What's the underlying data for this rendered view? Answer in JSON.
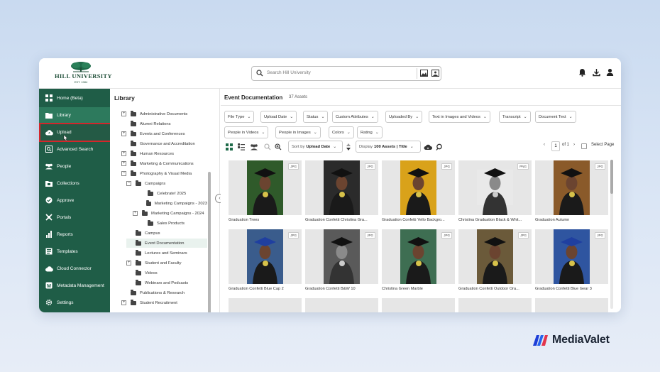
{
  "header": {
    "logo_name": "HILL UNIVERSITY",
    "logo_est": "EST. 1984",
    "search_placeholder": "Search Hill University"
  },
  "sidebar": {
    "items": [
      {
        "label": "Home (Beta)",
        "icon": "home-icon"
      },
      {
        "label": "Library",
        "icon": "folder-icon"
      },
      {
        "label": "Upload",
        "icon": "cloud-upload-icon"
      },
      {
        "label": "Advanced Search",
        "icon": "advanced-search-icon"
      },
      {
        "label": "People",
        "icon": "people-icon"
      },
      {
        "label": "Collections",
        "icon": "collections-icon"
      },
      {
        "label": "Approve",
        "icon": "approve-icon"
      },
      {
        "label": "Portals",
        "icon": "portals-icon"
      },
      {
        "label": "Reports",
        "icon": "reports-icon"
      },
      {
        "label": "Templates",
        "icon": "templates-icon"
      },
      {
        "label": "Cloud Connector",
        "icon": "cloud-connector-icon"
      },
      {
        "label": "Metadata Management",
        "icon": "metadata-icon"
      },
      {
        "label": "Settings",
        "icon": "gear-icon"
      }
    ]
  },
  "tree": {
    "title": "Library",
    "nodes": [
      {
        "label": "Administrative Documents",
        "expander": "+"
      },
      {
        "label": "Alumni Relations",
        "expander": ""
      },
      {
        "label": "Events and Conferences",
        "expander": "+"
      },
      {
        "label": "Governance and Accreditation",
        "expander": ""
      },
      {
        "label": "Human Resources",
        "expander": "+"
      },
      {
        "label": "Marketing & Communications",
        "expander": "+"
      },
      {
        "label": "Photography & Visual Media",
        "expander": "−"
      },
      {
        "label": "Campaigns",
        "expander": "−"
      },
      {
        "label": "Celebrate! 2025",
        "expander": ""
      },
      {
        "label": "Marketing Campaigns - 2023",
        "expander": ""
      },
      {
        "label": "Marketing Campaigns - 2024",
        "expander": "+"
      },
      {
        "label": "Sales Products",
        "expander": ""
      },
      {
        "label": "Campus",
        "expander": ""
      },
      {
        "label": "Event Documentation",
        "expander": ""
      },
      {
        "label": "Lectures and Seminars",
        "expander": ""
      },
      {
        "label": "Student and Faculty",
        "expander": "+"
      },
      {
        "label": "Videos",
        "expander": ""
      },
      {
        "label": "Webinars and Podcasts",
        "expander": ""
      },
      {
        "label": "Publications & Research",
        "expander": ""
      },
      {
        "label": "Student Recruitment",
        "expander": "+"
      }
    ]
  },
  "main": {
    "title": "Event Documentation",
    "count": "37 Assets",
    "filters": [
      "File Type",
      "Upload Date",
      "Status",
      "Custom Attributes",
      "Uploaded By",
      "Text in Images and Videos",
      "Transcript",
      "Document Text",
      "People in Videos",
      "People in Images",
      "Colors",
      "Rating"
    ],
    "sort_prefix": "Sort by",
    "sort_value": "Upload Date",
    "display_prefix": "Display",
    "display_value": "100 Assets | Title",
    "page_current": "1",
    "page_of": "of 1",
    "select_page": "Select Page",
    "assets": [
      {
        "caption": "Graduation Trees",
        "type": "JPG"
      },
      {
        "caption": "Graduation Confetti Christina Gra...",
        "type": "JPG"
      },
      {
        "caption": "Graduation Confetti Yello Backgro...",
        "type": "JPG"
      },
      {
        "caption": "Christina Graduation Black & Whit...",
        "type": "PNG"
      },
      {
        "caption": "Graduation Autumn",
        "type": "JPG"
      },
      {
        "caption": "Graduation Confetti Blue Cap 2",
        "type": "JPG"
      },
      {
        "caption": "Graduation Confetti B&W 10",
        "type": "JPG"
      },
      {
        "caption": "Christina Green Marble",
        "type": "JPG"
      },
      {
        "caption": "Graduation Confetti Outdoor Ora...",
        "type": "JPG"
      },
      {
        "caption": "Graduation Confetti Blue Gear 3",
        "type": "JPG"
      }
    ]
  },
  "brand": {
    "name": "MediaValet"
  },
  "colors": {
    "sidebar": "#1f5d47",
    "sidebar_active": "#2d7a5d",
    "highlight_box": "#d4262b"
  }
}
